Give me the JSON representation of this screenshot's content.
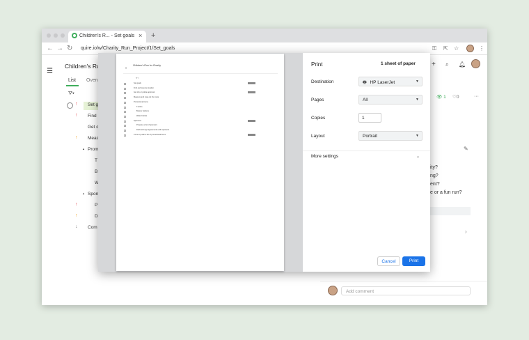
{
  "browser": {
    "tab_title": "Children's R... - Set goals - Qu",
    "url": "quire.io/w/Charity_Run_Project/1/Set_goals"
  },
  "app": {
    "project_title": "Children's Ru",
    "tabs": [
      "List",
      "Overv"
    ],
    "tasks": [
      {
        "label": "Set g",
        "arrow": "↑",
        "kind": "up-red"
      },
      {
        "label": "Find",
        "arrow": "↑",
        "kind": "up-red"
      },
      {
        "label": "Get c",
        "arrow": "",
        "kind": ""
      },
      {
        "label": "Meas",
        "arrow": "↑",
        "kind": "up-or"
      },
      {
        "label": "Prom",
        "arrow": "",
        "kind": ""
      },
      {
        "label": "T",
        "arrow": "",
        "kind": ""
      },
      {
        "label": "B",
        "arrow": "",
        "kind": ""
      },
      {
        "label": "W",
        "arrow": "",
        "kind": ""
      },
      {
        "label": "Spon",
        "arrow": "",
        "kind": ""
      },
      {
        "label": "P",
        "arrow": "↑",
        "kind": "up-red"
      },
      {
        "label": "D",
        "arrow": "↑",
        "kind": "up-or"
      },
      {
        "label": "Com",
        "arrow": "↓",
        "kind": "down-gr"
      }
    ],
    "right_panel": {
      "watch_count": "1",
      "like_count": "0",
      "questions": [
        "ity?",
        "ng?",
        "ent?",
        "e or a fun run?"
      ],
      "comment_placeholder": "Add comment"
    }
  },
  "print_dialog": {
    "title": "Print",
    "sheets": "1 sheet of paper",
    "destination_label": "Destination",
    "destination_value": "HP LaserJet",
    "pages_label": "Pages",
    "pages_value": "All",
    "copies_label": "Copies",
    "copies_value": "1",
    "layout_label": "Layout",
    "layout_value": "Portrait",
    "more_settings": "More settings",
    "cancel": "Cancel",
    "print": "Print",
    "preview": {
      "title": "Children's Run for Charity",
      "rows": [
        "Set goals",
        "Find and reserve location",
        "Get city or police approval",
        "Measure and map out the route",
        "Promotional items",
        "T-shirts",
        "Banner stickers",
        "Water bottles",
        "Sponsors",
        "Propose a list of sponsors",
        "Draft and sign agreements with sponsors",
        "Come up with a list of promotional items"
      ]
    }
  },
  "colors": {
    "accent": "#1a73e8",
    "brand_green": "#3fae5c",
    "priority_red": "#e2454b",
    "priority_orange": "#f0a528"
  }
}
